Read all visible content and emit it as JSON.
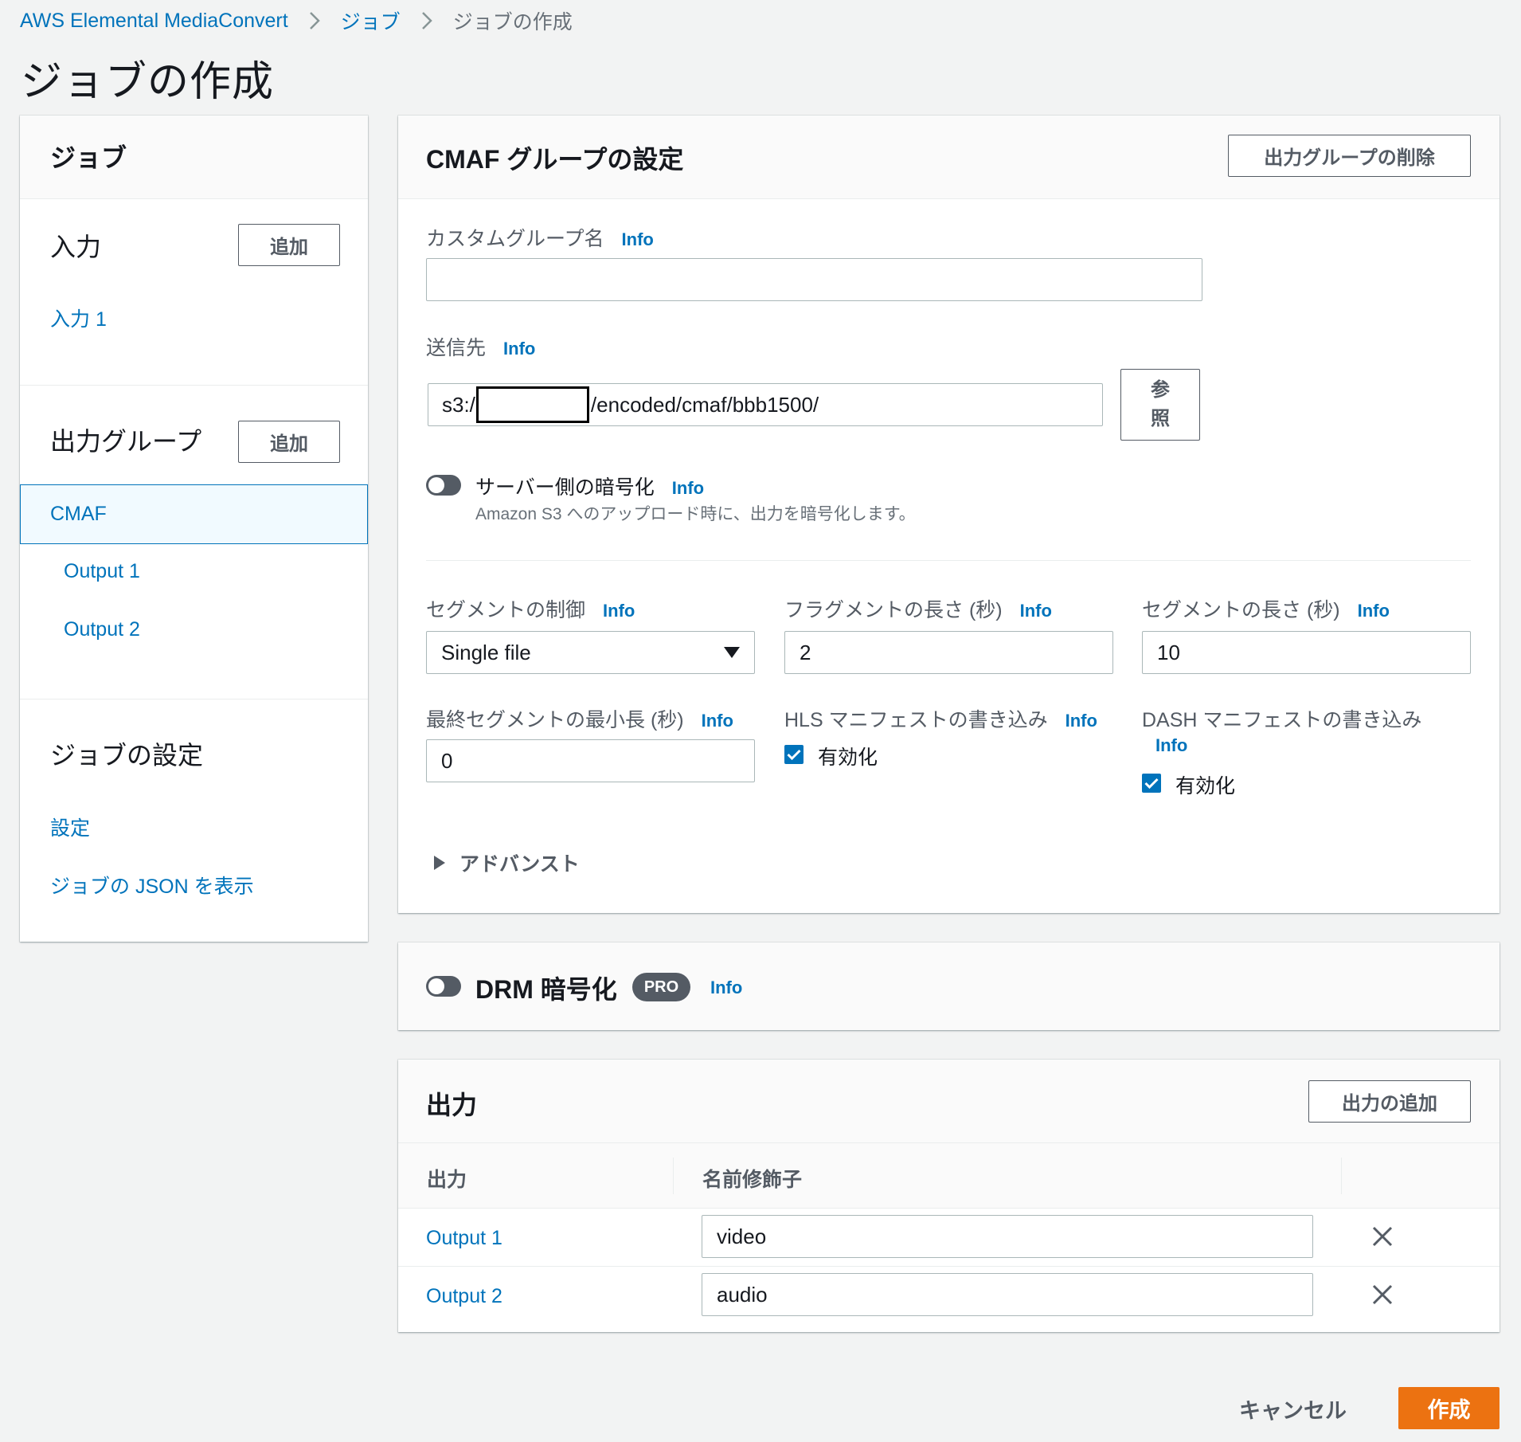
{
  "breadcrumb": {
    "root": "AWS Elemental MediaConvert",
    "jobs": "ジョブ",
    "current": "ジョブの作成"
  },
  "page_title": "ジョブの作成",
  "sidebar": {
    "title": "ジョブ",
    "input_section": {
      "title": "入力",
      "add_label": "追加",
      "items": [
        "入力 1"
      ]
    },
    "output_group_section": {
      "title": "出力グループ",
      "add_label": "追加",
      "selected_group": "CMAF",
      "outputs": [
        "Output 1",
        "Output 2"
      ]
    },
    "job_settings_section": {
      "title": "ジョブの設定",
      "links": [
        "設定",
        "ジョブの JSON を表示"
      ]
    }
  },
  "cmaf_panel": {
    "title": "CMAF グループの設定",
    "delete_label": "出力グループの削除",
    "custom_group_name": {
      "label": "カスタムグループ名",
      "info": "Info",
      "value": ""
    },
    "destination": {
      "label": "送信先",
      "info": "Info",
      "prefix": "s3:/",
      "suffix": "/encoded/cmaf/bbb1500/",
      "browse_label_line1": "参",
      "browse_label_line2": "照"
    },
    "server_side_encryption": {
      "label": "サーバー側の暗号化",
      "info": "Info",
      "description": "Amazon S3 へのアップロード時に、出力を暗号化します。"
    },
    "segment_control": {
      "label": "セグメントの制御",
      "info": "Info",
      "value": "Single file"
    },
    "fragment_length": {
      "label": "フラグメントの長さ (秒)",
      "info": "Info",
      "value": "2"
    },
    "segment_length": {
      "label": "セグメントの長さ (秒)",
      "info": "Info",
      "value": "10"
    },
    "min_final_segment": {
      "label": "最終セグメントの最小長 (秒)",
      "info": "Info",
      "value": "0"
    },
    "hls_manifest": {
      "label": "HLS マニフェストの書き込み",
      "info": "Info",
      "checkbox_label": "有効化",
      "checked": true
    },
    "dash_manifest": {
      "label": "DASH マニフェストの書き込み",
      "info": "Info",
      "checkbox_label": "有効化",
      "checked": true
    },
    "advanced_label": "アドバンスト"
  },
  "drm_panel": {
    "title": "DRM 暗号化",
    "badge": "PRO",
    "info": "Info"
  },
  "outputs_panel": {
    "title": "出力",
    "add_label": "出力の追加",
    "columns": [
      "出力",
      "名前修飾子"
    ],
    "rows": [
      {
        "name": "Output 1",
        "modifier": "video"
      },
      {
        "name": "Output 2",
        "modifier": "audio"
      }
    ]
  },
  "footer": {
    "cancel_label": "キャンセル",
    "create_label": "作成"
  },
  "colors": {
    "link": "#0073bb",
    "primary": "#ec7211",
    "selected_bg": "#f1faff"
  }
}
